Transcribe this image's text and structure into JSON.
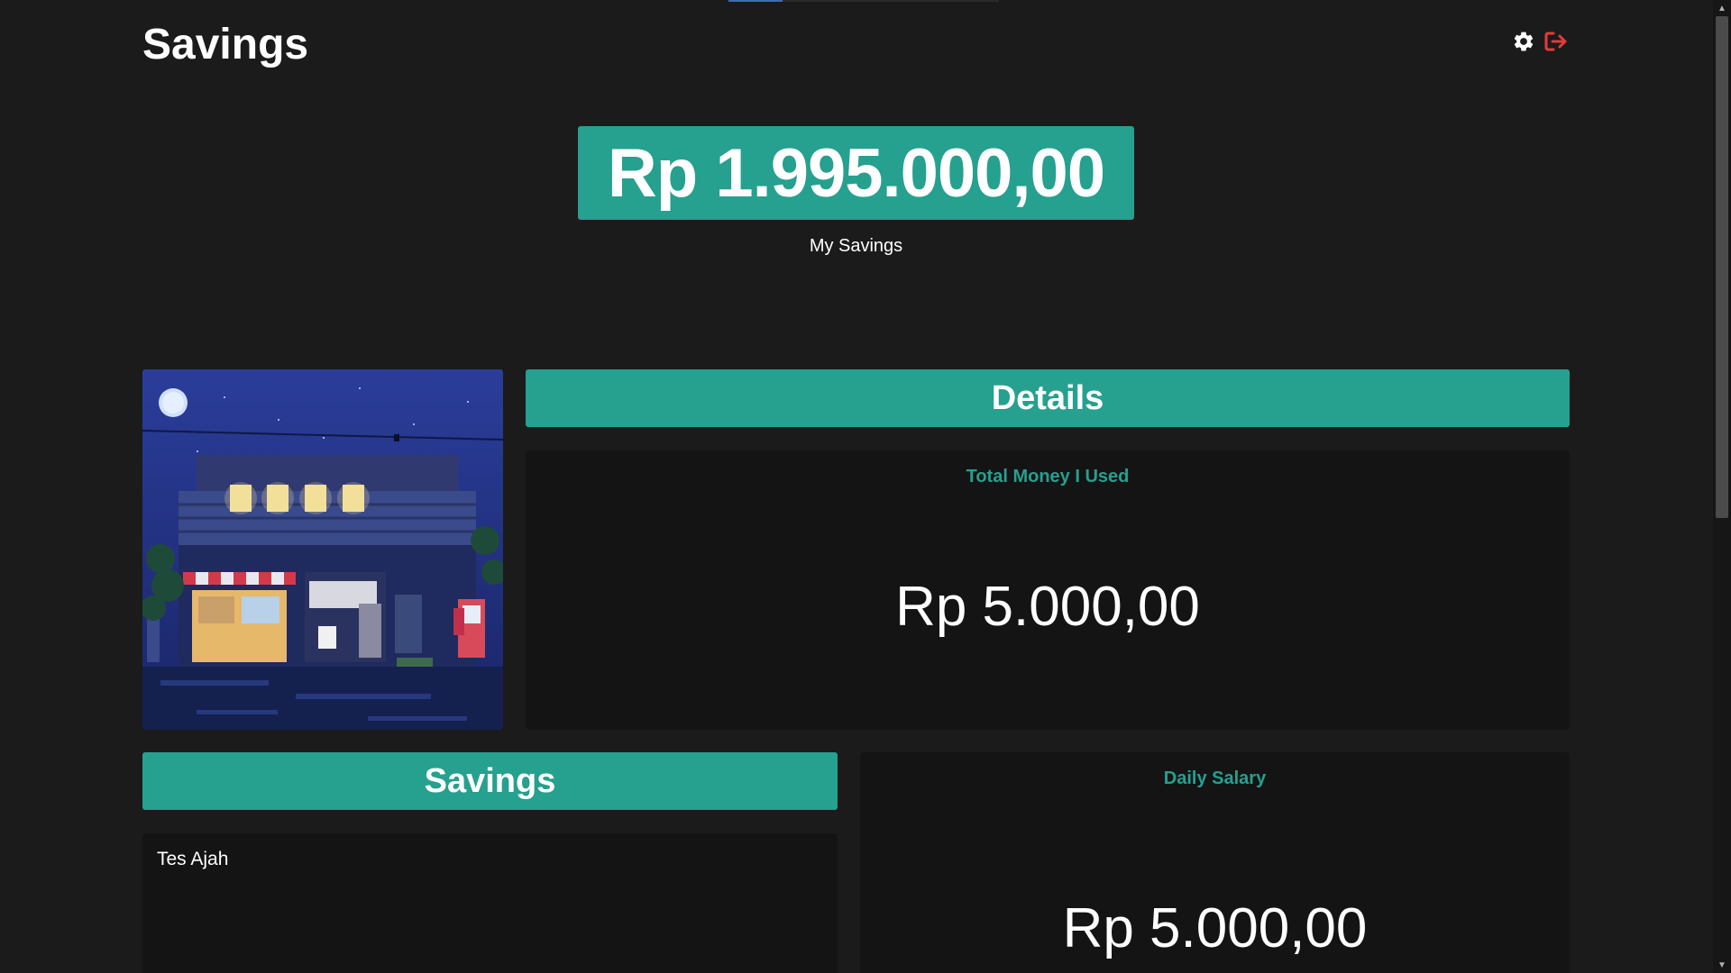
{
  "app": {
    "title": "Savings"
  },
  "header": {
    "settings_icon": "gear-icon",
    "logout_icon": "logout-icon",
    "logout_color": "#e03b3b"
  },
  "hero": {
    "amount": "Rp 1.995.000,00",
    "caption": "My Savings"
  },
  "details": {
    "title": "Details",
    "total_used_label": "Total Money I Used",
    "total_used_amount": "Rp 5.000,00"
  },
  "savings": {
    "title": "Savings",
    "items": [
      {
        "name": "Tes Ajah"
      }
    ]
  },
  "daily_salary": {
    "label": "Daily Salary",
    "amount": "Rp 5.000,00"
  },
  "theme": {
    "accent": "#26a08f",
    "background": "#1b1b1b",
    "card": "#141414"
  }
}
